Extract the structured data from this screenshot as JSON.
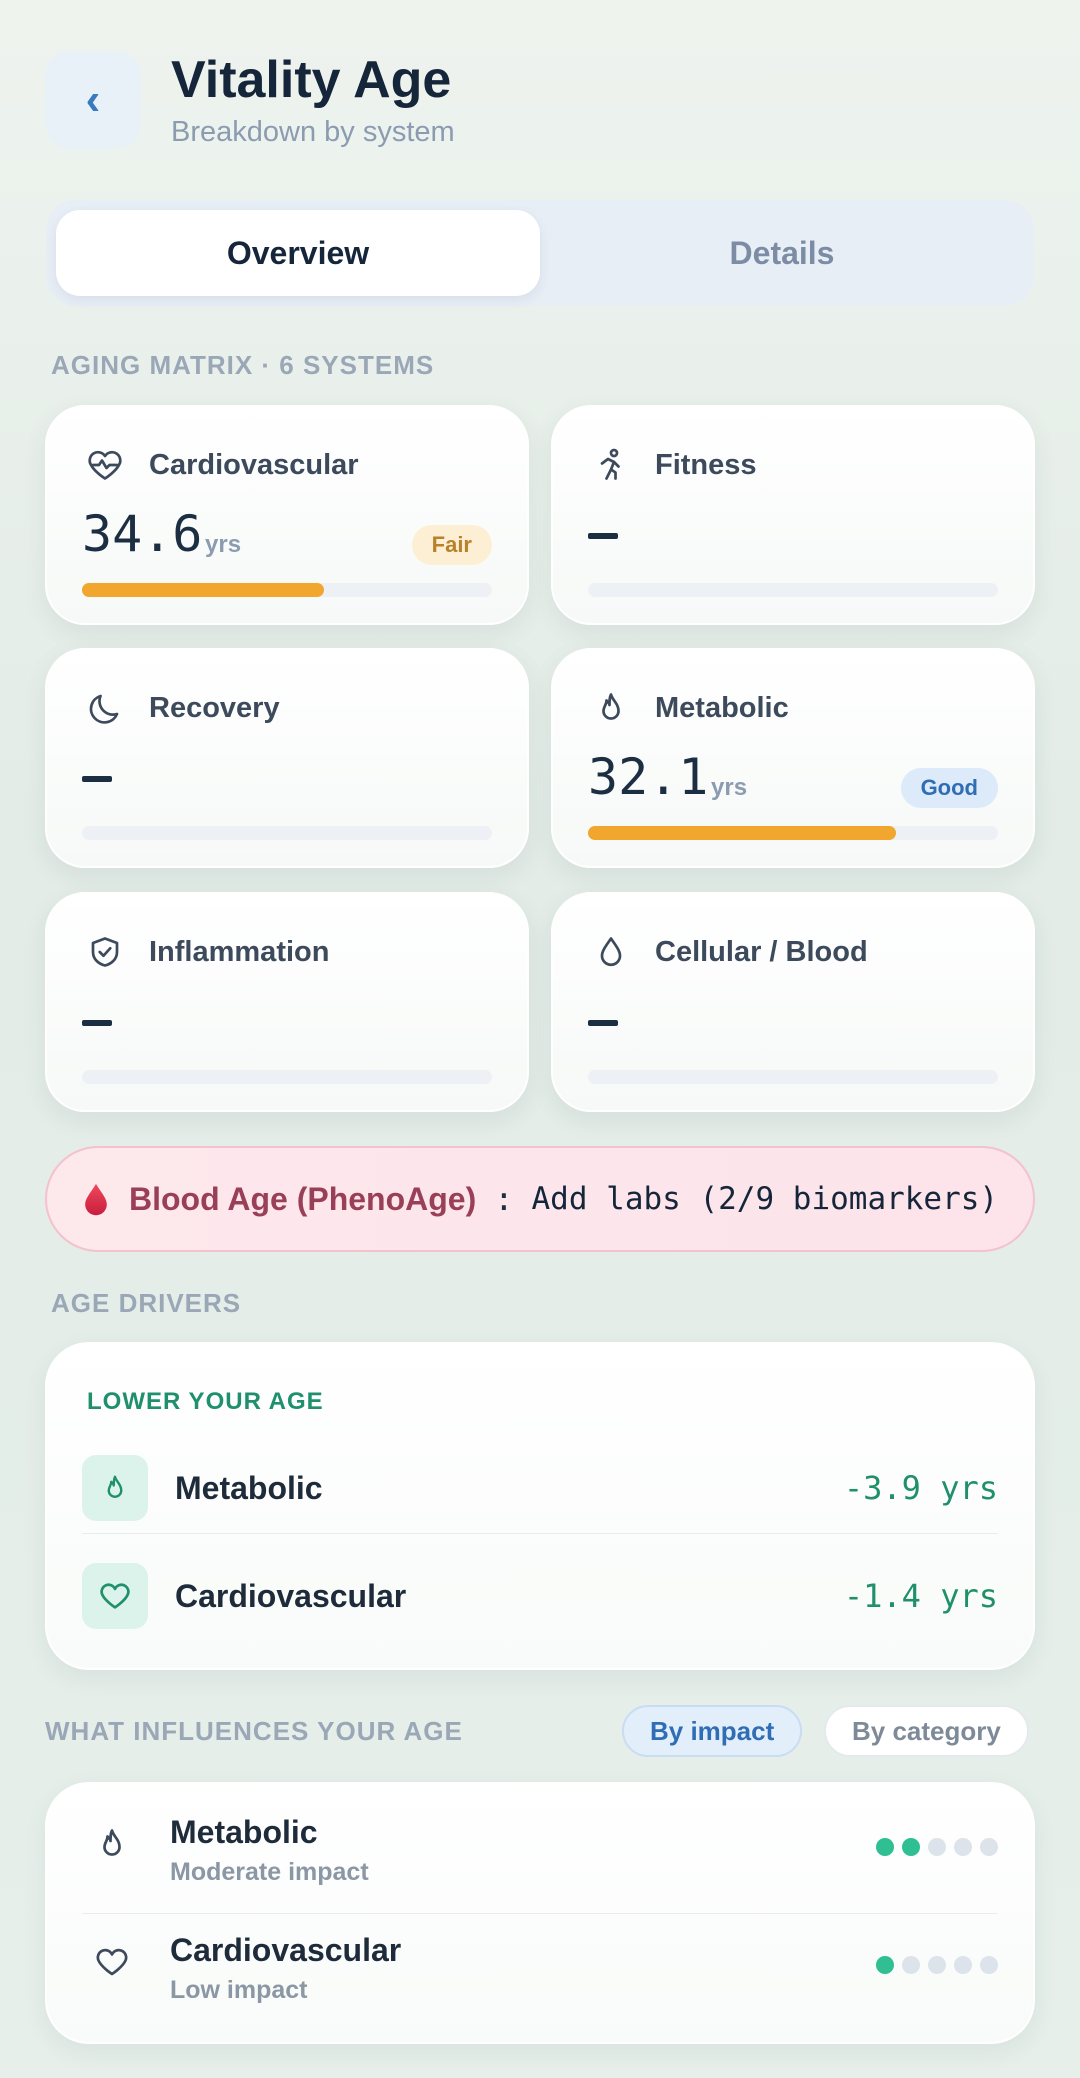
{
  "header": {
    "back_icon": "chevron-left-icon",
    "title": "Vitality Age",
    "subtitle": "Breakdown by system"
  },
  "tabs": [
    {
      "label": "Overview",
      "active": true
    },
    {
      "label": "Details",
      "active": false
    }
  ],
  "matrix": {
    "section_label": "AGING MATRIX · 6 SYSTEMS",
    "cards": [
      {
        "name": "Cardiovascular",
        "icon": "heart-pulse-icon",
        "value": "34.6",
        "unit": "yrs",
        "badge": "Fair",
        "progress": 0.59
      },
      {
        "name": "Fitness",
        "icon": "runner-icon",
        "value": "",
        "unit": "",
        "badge": "",
        "progress": 0
      },
      {
        "name": "Recovery",
        "icon": "moon-icon",
        "value": "",
        "unit": "",
        "badge": "",
        "progress": 0
      },
      {
        "name": "Metabolic",
        "icon": "flame-icon",
        "value": "32.1",
        "unit": "yrs",
        "badge": "Good",
        "progress": 0.75
      },
      {
        "name": "Inflammation",
        "icon": "shield-check-icon",
        "value": "",
        "unit": "",
        "badge": "",
        "progress": 0
      },
      {
        "name": "Cellular / Blood",
        "icon": "droplet-icon",
        "value": "",
        "unit": "",
        "badge": "",
        "progress": 0
      }
    ]
  },
  "blood": {
    "icon": "blood-drop-icon",
    "label": "Blood Age (PhenoAge)",
    "separator": ":",
    "action": "Add labs (2/9 biomarkers)"
  },
  "drivers": {
    "section_label": "AGE DRIVERS",
    "heading": "LOWER YOUR AGE",
    "items": [
      {
        "name": "Metabolic",
        "icon": "flame-icon",
        "delta": "-3.9 yrs"
      },
      {
        "name": "Cardiovascular",
        "icon": "heart-icon",
        "delta": "-1.4 yrs"
      }
    ]
  },
  "influences": {
    "section_label": "WHAT INFLUENCES YOUR AGE",
    "filters": [
      {
        "label": "By impact",
        "active": true
      },
      {
        "label": "By category",
        "active": false
      }
    ],
    "items": [
      {
        "name": "Metabolic",
        "icon": "flame-icon",
        "impact": "Moderate impact",
        "level": 2,
        "max": 5
      },
      {
        "name": "Cardiovascular",
        "icon": "heart-icon",
        "impact": "Low impact",
        "level": 1,
        "max": 5
      }
    ]
  },
  "colors": {
    "accent_green": "#2fbf92",
    "bar_orange": "#f1a62e",
    "blue": "#2f6db5"
  }
}
